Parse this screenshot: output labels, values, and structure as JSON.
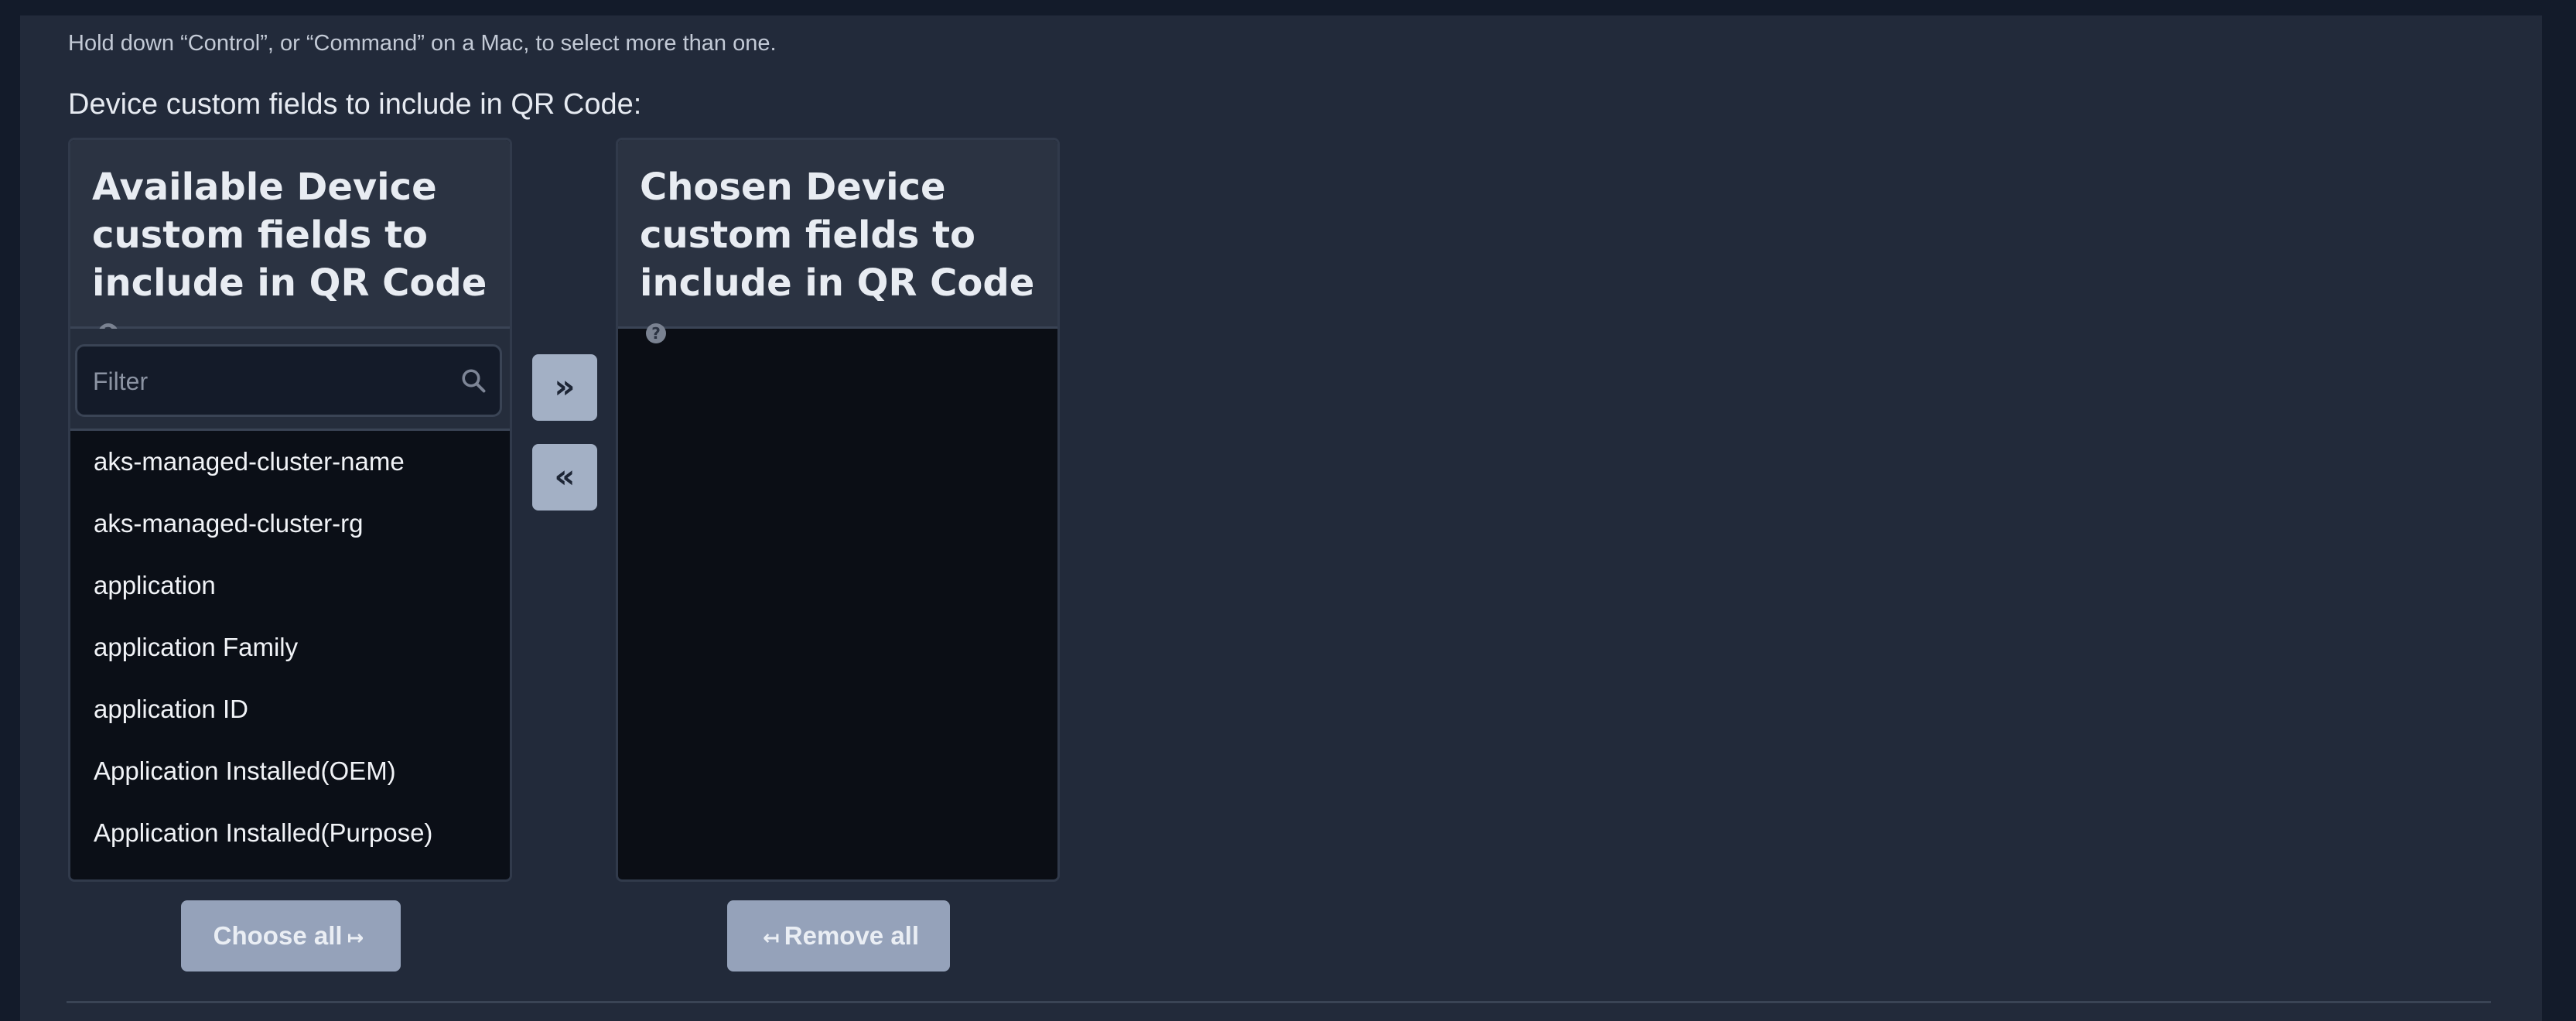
{
  "help_text": "Hold down “Control”, or “Command” on a Mac, to select more than one.",
  "field_label": "Device custom fields to include in QR Code:",
  "available": {
    "title": "Available Device custom fields to include in QR Code",
    "help_icon": "question-circle-icon",
    "filter_placeholder": "Filter",
    "search_icon": "search-icon",
    "items": [
      "aks-managed-cluster-name",
      "aks-managed-cluster-rg",
      "application",
      "application Family",
      "application ID",
      "Application Installed(OEM)",
      "Application Installed(Purpose)"
    ]
  },
  "chosen": {
    "title": "Chosen Device custom fields to include in QR Code",
    "help_icon": "question-circle-icon",
    "items": []
  },
  "controls": {
    "add_label": "»",
    "remove_label": "«",
    "choose_all_label": "Choose all",
    "choose_all_icon": "↦",
    "remove_all_label": "Remove all",
    "remove_all_icon": "↤"
  },
  "colors": {
    "page_bg": "#131b2a",
    "panel_bg": "#222a3a",
    "header_bg": "#2b3342",
    "list_bg": "#0b0f17",
    "button_bg": "#a3b0c5",
    "bulk_button_bg": "#95a2ba"
  }
}
